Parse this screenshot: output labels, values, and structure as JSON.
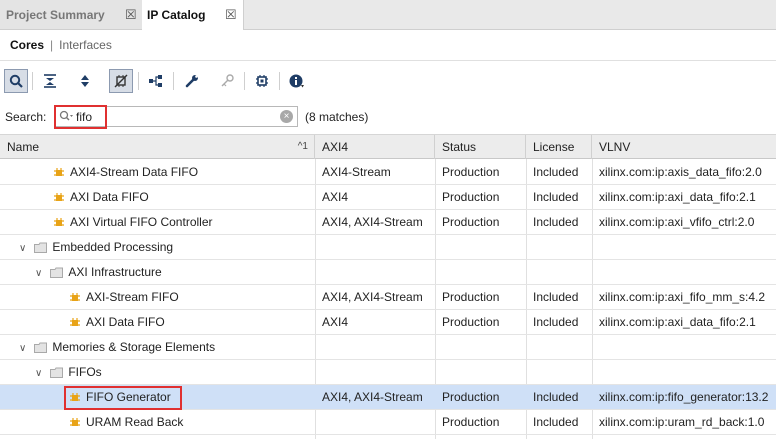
{
  "tabs": [
    {
      "label": "Project Summary",
      "close": "☒"
    },
    {
      "label": "IP Catalog",
      "close": "☒"
    }
  ],
  "subtabs": {
    "cores": "Cores",
    "separator": "|",
    "interfaces": "Interfaces"
  },
  "toolbar": {
    "icons": [
      "search-icon",
      "collapse-all-icon",
      "expand-all-icon",
      "customize-ip-icon",
      "hierarchy-icon",
      "wrench-icon",
      "key-icon",
      "chip-icon",
      "info-icon"
    ]
  },
  "search": {
    "label": "Search:",
    "value": "fifo",
    "matches": "(8 matches)",
    "clear": "×"
  },
  "table": {
    "headers": {
      "name": "Name",
      "sort": "^1",
      "axi4": "AXI4",
      "status": "Status",
      "license": "License",
      "vlnv": "VLNV"
    },
    "rows": [
      {
        "type": "ip",
        "name": "AXI4-Stream Data FIFO",
        "axi4": "AXI4-Stream",
        "status": "Production",
        "license": "Included",
        "vlnv": "xilinx.com:ip:axis_data_fifo:2.0"
      },
      {
        "type": "ip",
        "name": "AXI Data FIFO",
        "axi4": "AXI4",
        "status": "Production",
        "license": "Included",
        "vlnv": "xilinx.com:ip:axi_data_fifo:2.1"
      },
      {
        "type": "ip",
        "name": "AXI Virtual FIFO Controller",
        "axi4": "AXI4, AXI4-Stream",
        "status": "Production",
        "license": "Included",
        "vlnv": "xilinx.com:ip:axi_vfifo_ctrl:2.0"
      },
      {
        "type": "folder",
        "name": "Embedded Processing",
        "expand": "∨"
      },
      {
        "type": "folder",
        "name": "AXI Infrastructure",
        "expand": "∨"
      },
      {
        "type": "ip",
        "name": "AXI-Stream FIFO",
        "axi4": "AXI4, AXI4-Stream",
        "status": "Production",
        "license": "Included",
        "vlnv": "xilinx.com:ip:axi_fifo_mm_s:4.2"
      },
      {
        "type": "ip",
        "name": "AXI Data FIFO",
        "axi4": "AXI4",
        "status": "Production",
        "license": "Included",
        "vlnv": "xilinx.com:ip:axi_data_fifo:2.1"
      },
      {
        "type": "folder",
        "name": "Memories & Storage Elements",
        "expand": "∨"
      },
      {
        "type": "folder",
        "name": "FIFOs",
        "expand": "∨"
      },
      {
        "type": "ip",
        "name": "FIFO Generator",
        "axi4": "AXI4, AXI4-Stream",
        "status": "Production",
        "license": "Included",
        "vlnv": "xilinx.com:ip:fifo_generator:13.2",
        "selected": true
      },
      {
        "type": "ip",
        "name": "URAM Read Back",
        "axi4": "",
        "status": "Production",
        "license": "Included",
        "vlnv": "xilinx.com:ip:uram_rd_back:1.0"
      }
    ]
  },
  "colors": {
    "highlight": "#e03030",
    "selected_row": "#cfe0f7",
    "ip_icon": "#e8a317",
    "folder_icon": "#c9c9c9"
  }
}
